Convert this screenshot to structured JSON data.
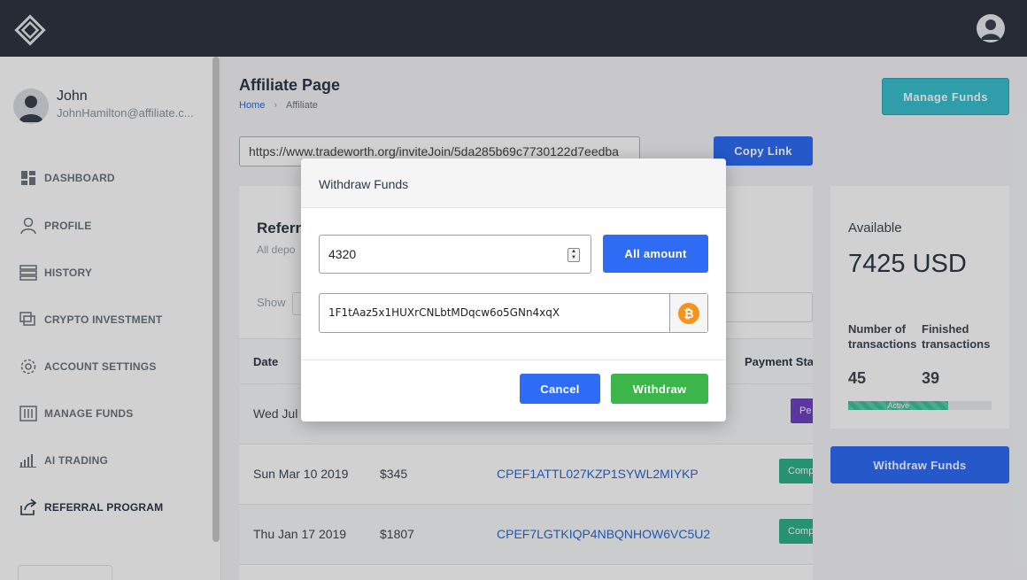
{
  "header": {
    "logo_icon": "diamond-logo-icon",
    "avatar_icon": "user-avatar-icon"
  },
  "sidebar": {
    "user": {
      "name": "John",
      "email": "JohnHamilton@affiliate.c..."
    },
    "items": [
      {
        "label": "DASHBOARD",
        "icon": "dashboard-icon",
        "active": false
      },
      {
        "label": "PROFILE",
        "icon": "profile-icon",
        "active": false
      },
      {
        "label": "HISTORY",
        "icon": "history-icon",
        "active": false
      },
      {
        "label": "CRYPTO INVESTMENT",
        "icon": "crypto-investment-icon",
        "active": false
      },
      {
        "label": "ACCOUNT SETTINGS",
        "icon": "gear-icon",
        "active": false
      },
      {
        "label": "MANAGE FUNDS",
        "icon": "sliders-icon",
        "active": false
      },
      {
        "label": "AI TRADING",
        "icon": "bar-chart-icon",
        "active": false
      },
      {
        "label": "REFERRAL PROGRAM",
        "icon": "share-icon",
        "active": true
      }
    ]
  },
  "page": {
    "title": "Affiliate Page",
    "breadcrumb": {
      "home": "Home",
      "separator": "›",
      "current": "Affiliate"
    },
    "manage_funds_label": "Manage Funds",
    "invite_link": "https://www.tradeworth.org/inviteJoin/5da285b69c7730122d7eedba",
    "copy_link_label": "Copy Link"
  },
  "referrals": {
    "title": "Referr",
    "subtitle": "All depo",
    "show_label": "Show",
    "columns": {
      "date": "Date",
      "payment_status": "Payment Sta"
    },
    "rows": [
      {
        "date": "Wed Jul",
        "amount": "",
        "code": "",
        "status": "Pe",
        "status_color": "#6f42c1"
      },
      {
        "date": "Sun Mar 10 2019",
        "amount": "$345",
        "code": "CPEF1ATTL027KZP1SYWL2MIYKP",
        "status": "Comp",
        "status_color": "#2fb38a"
      },
      {
        "date": "Thu Jan 17 2019",
        "amount": "$1807",
        "code": "CPEF7LGTKIQP4NBQNHOW6VC5U2",
        "status": "Comp",
        "status_color": "#2fb38a"
      }
    ]
  },
  "summary": {
    "available_label": "Available",
    "available_value": "7425 USD",
    "num_transactions_label_1": "Number of",
    "num_transactions_label_2": "transactions",
    "finished_label_1": "Finished",
    "finished_label_2": "transactions",
    "num_transactions": "45",
    "finished_transactions": "39",
    "progress_label": "Active",
    "progress_percent": 70,
    "withdraw_funds_label": "Withdraw Funds"
  },
  "modal": {
    "title": "Withdraw Funds",
    "amount_value": "4320",
    "all_amount_label": "All amount",
    "address_value": "1F1tAaz5x1HUXrCNLbtMDqcw6o5GNn4xqX",
    "address_icon": "bitcoin-icon",
    "bitcoin_symbol": "₿",
    "cancel_label": "Cancel",
    "withdraw_label": "Withdraw"
  },
  "colors": {
    "topbar": "#2f3541",
    "primary": "#2e6cf5",
    "teal": "#3ac0d0",
    "success": "#3cb54a",
    "bitcoin": "#f7931a"
  }
}
